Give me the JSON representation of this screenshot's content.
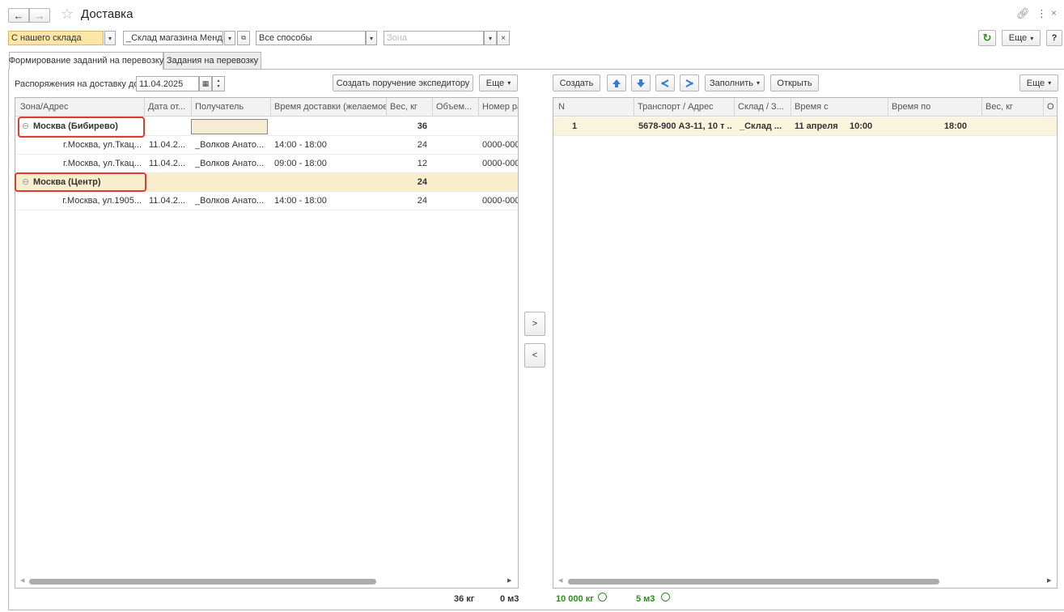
{
  "window": {
    "title": "Доставка"
  },
  "filters": {
    "source": "С нашего склада",
    "warehouse": "_Склад магазина Мендел",
    "method": "Все способы",
    "zone_placeholder": "Зона"
  },
  "toolbar_right": {
    "more_label": "Еще",
    "help_label": "?"
  },
  "tabs": [
    {
      "label": "Формирование заданий на перевозку"
    },
    {
      "label": "Задания на перевозку"
    }
  ],
  "left_panel": {
    "date_label": "Распоряжения на доставку до:",
    "date_value": "11.04.2025",
    "create_order_label": "Создать поручение экспедитору",
    "more_label": "Еще",
    "columns": [
      "Зона/Адрес",
      "Дата от...",
      "Получатель",
      "Время доставки (желаемое)",
      "Вес, кг",
      "Объем...",
      "Номер ра"
    ],
    "groups": [
      {
        "name": "Москва (Бибирево)",
        "weight": "36",
        "rows": [
          {
            "address": "г.Москва, ул.Ткац...",
            "date": "11.04.2...",
            "recipient": "_Волков Анато...",
            "time": "14:00 - 18:00",
            "weight": "24",
            "number": "0000-000"
          },
          {
            "address": "г.Москва, ул.Ткац...",
            "date": "11.04.2...",
            "recipient": "_Волков Анато...",
            "time": "09:00 - 18:00",
            "weight": "12",
            "number": "0000-000"
          }
        ]
      },
      {
        "name": "Москва (Центр)",
        "weight": "24",
        "rows": [
          {
            "address": "г.Москва, ул.1905...",
            "date": "11.04.2...",
            "recipient": "_Волков Анато...",
            "time": "14:00 - 18:00",
            "weight": "24",
            "number": "0000-000"
          }
        ]
      }
    ],
    "footer": {
      "weight": "36 кг",
      "volume": "0 м3"
    }
  },
  "transfer": {
    "right_label": ">",
    "left_label": "<"
  },
  "right_panel": {
    "create_label": "Создать",
    "fill_label": "Заполнить",
    "open_label": "Открыть",
    "more_label": "Еще",
    "columns": [
      "N",
      "Транспорт / Адрес",
      "Склад / З...",
      "Время с",
      "Время по",
      "Вес, кг",
      "О"
    ],
    "rows": [
      {
        "n": "1",
        "transport": "5678-900 АЗ-11, 10 т ...",
        "warehouse": "_Склад ...",
        "date": "11 апреля",
        "time_from": "10:00",
        "time_to": "18:00"
      }
    ],
    "footer": {
      "weight": "10 000 кг",
      "volume": "5 м3"
    }
  },
  "colors": {
    "accent_yellow": "#fbe6a8",
    "group_highlight": "#f8eecb",
    "selected_row": "#faf4dd",
    "red_box": "#e23a2e",
    "green_text": "#2e8b20"
  }
}
